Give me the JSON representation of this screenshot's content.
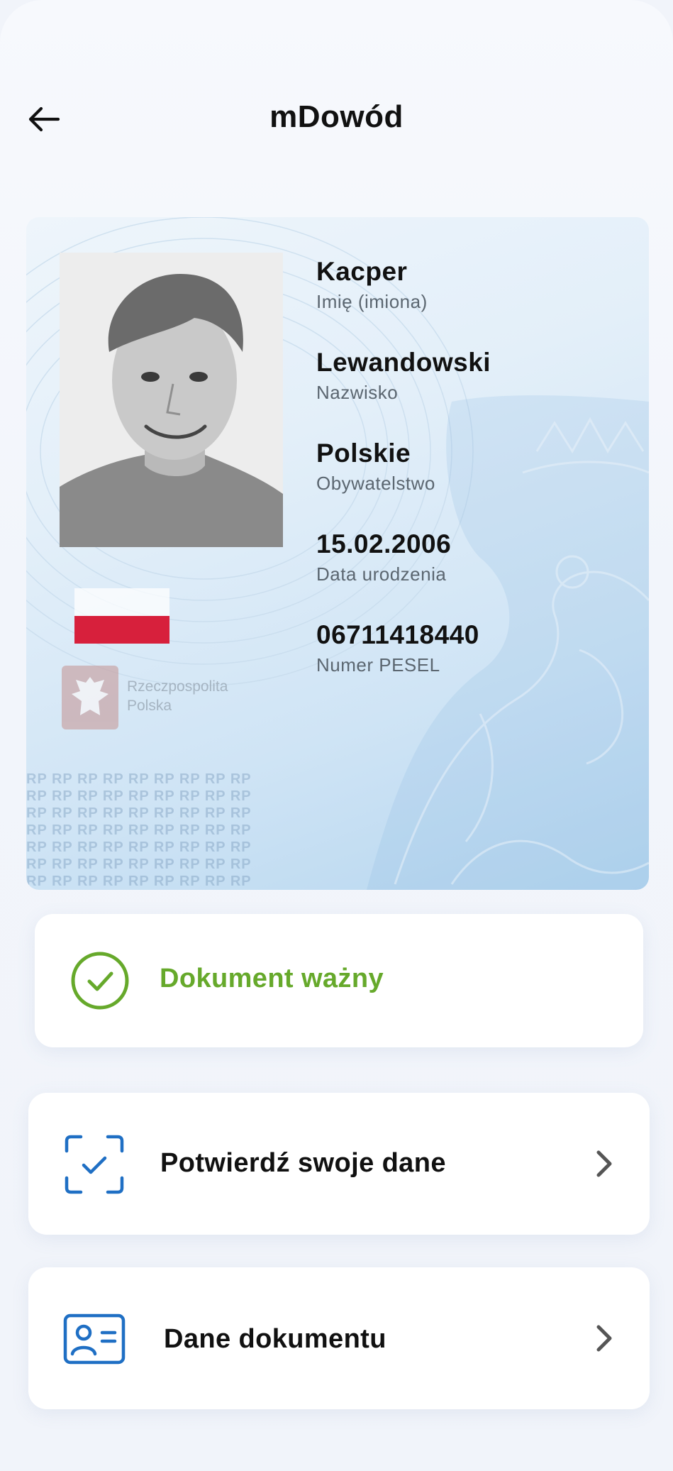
{
  "header": {
    "title": "mDowód"
  },
  "card": {
    "fields": [
      {
        "value": "Kacper",
        "label": "Imię (imiona)"
      },
      {
        "value": "Lewandowski",
        "label": "Nazwisko"
      },
      {
        "value": "Polskie",
        "label": "Obywatelstwo"
      },
      {
        "value": "15.02.2006",
        "label": "Data urodzenia"
      },
      {
        "value": "06711418440",
        "label": "Numer PESEL"
      }
    ],
    "emblem_text_line1": "Rzeczpospolita",
    "emblem_text_line2": "Polska",
    "background_pattern_text": "RP RP RP RP RP RP RP RP RP"
  },
  "status": {
    "label": "Dokument ważny",
    "icon": "check-circle-icon",
    "color": "#66a92b"
  },
  "actions": [
    {
      "label": "Potwierdź swoje dane",
      "icon": "scan-check-icon"
    },
    {
      "label": "Dane dokumentu",
      "icon": "id-card-icon"
    }
  ],
  "colors": {
    "accent_blue": "#1f6fc4",
    "valid_green": "#66a92b",
    "flag_red": "#d7203c"
  }
}
